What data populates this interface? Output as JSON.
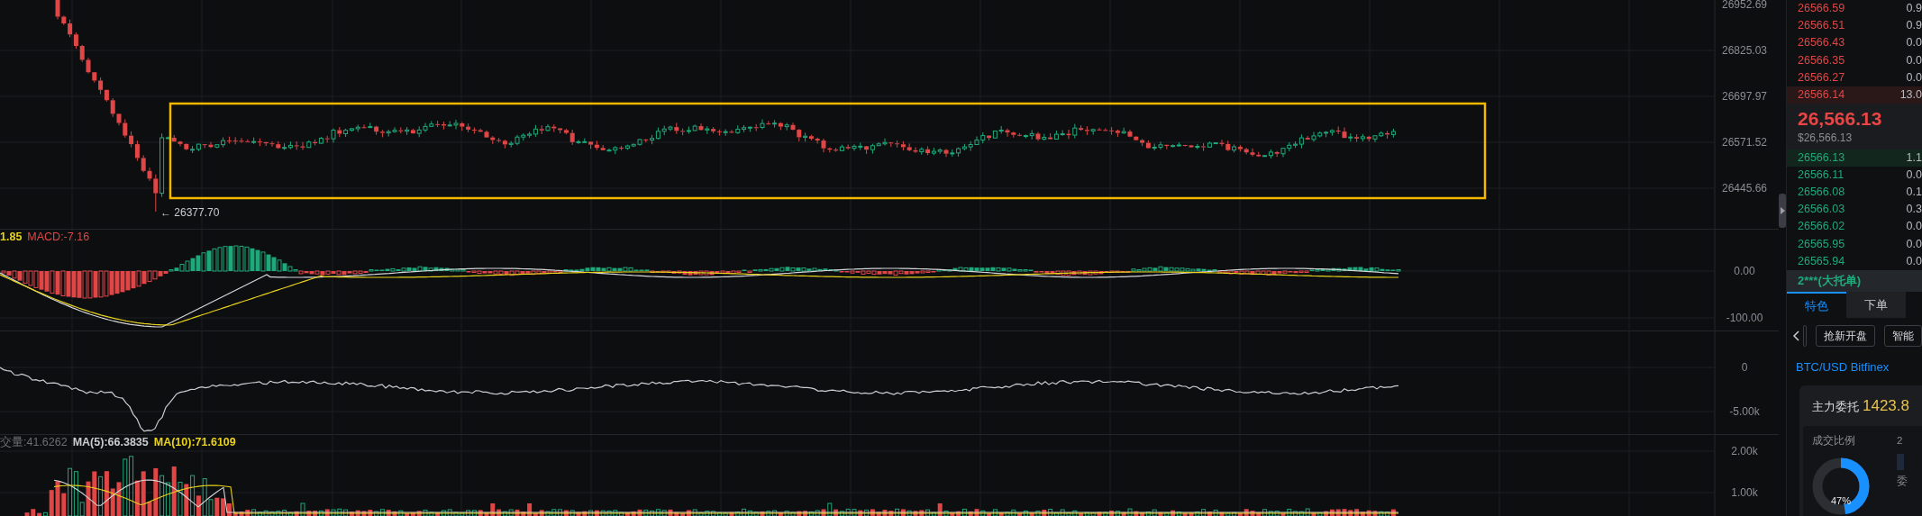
{
  "price_panel": {
    "axis_labels": [
      "26952.69",
      "26825.03",
      "26697.97",
      "26571.52",
      "26445.66"
    ],
    "low_marker": "← 26377.70"
  },
  "macd_panel": {
    "legend": [
      {
        "kind": "dif",
        "text": "1.85"
      },
      {
        "kind": "macd",
        "text": "MACD:-7.16"
      }
    ],
    "axis_labels": [
      "0.00",
      "-100.00"
    ]
  },
  "line_panel": {
    "axis_labels": [
      "0",
      "-5.00k"
    ]
  },
  "volume_panel": {
    "legend": [
      {
        "kind": "volume",
        "text": "交量:41.6262"
      },
      {
        "kind": "ma5",
        "text": "MA(5):66.3835"
      },
      {
        "kind": "ma10",
        "text": "MA(10):71.6109"
      }
    ],
    "axis_labels": [
      "2.00k",
      "1.00k"
    ]
  },
  "order_book": {
    "asks": [
      {
        "price": "26566.59",
        "amount": "0.9",
        "highlighted": false
      },
      {
        "price": "26566.51",
        "amount": "0.9",
        "highlighted": false
      },
      {
        "price": "26566.43",
        "amount": "0.0",
        "highlighted": false
      },
      {
        "price": "26566.35",
        "amount": "0.0",
        "highlighted": false
      },
      {
        "price": "26566.27",
        "amount": "0.0",
        "highlighted": false
      },
      {
        "price": "26566.14",
        "amount": "13.0",
        "highlighted": true
      }
    ],
    "last_price": "26,566.13",
    "last_price_usd": "$26,566.13",
    "bids": [
      {
        "price": "26566.13",
        "amount": "1.1",
        "highlighted": true
      },
      {
        "price": "26566.11",
        "amount": "0.0",
        "highlighted": false
      },
      {
        "price": "26566.08",
        "amount": "0.1",
        "highlighted": false
      },
      {
        "price": "26566.03",
        "amount": "0.3",
        "highlighted": false
      },
      {
        "price": "26566.02",
        "amount": "0.0",
        "highlighted": false
      },
      {
        "price": "26565.95",
        "amount": "0.0",
        "highlighted": false
      },
      {
        "price": "26565.94",
        "amount": "0.0",
        "highlighted": false
      }
    ],
    "big_order": "2***(大托单)"
  },
  "tabs": [
    {
      "label": "特色",
      "selected": true
    },
    {
      "label": "下单",
      "selected": false
    }
  ],
  "tool_buttons": [
    "抢新开盘",
    "智能"
  ],
  "pair": "BTC/USD Bitfinex",
  "main_order_card": {
    "label": "主力委托",
    "value": "1423.8",
    "ratio_label": "成交比例",
    "column_2_label": "2",
    "column_2_text": "委",
    "donut": {
      "level": 0.47,
      "text": "47%"
    }
  }
}
